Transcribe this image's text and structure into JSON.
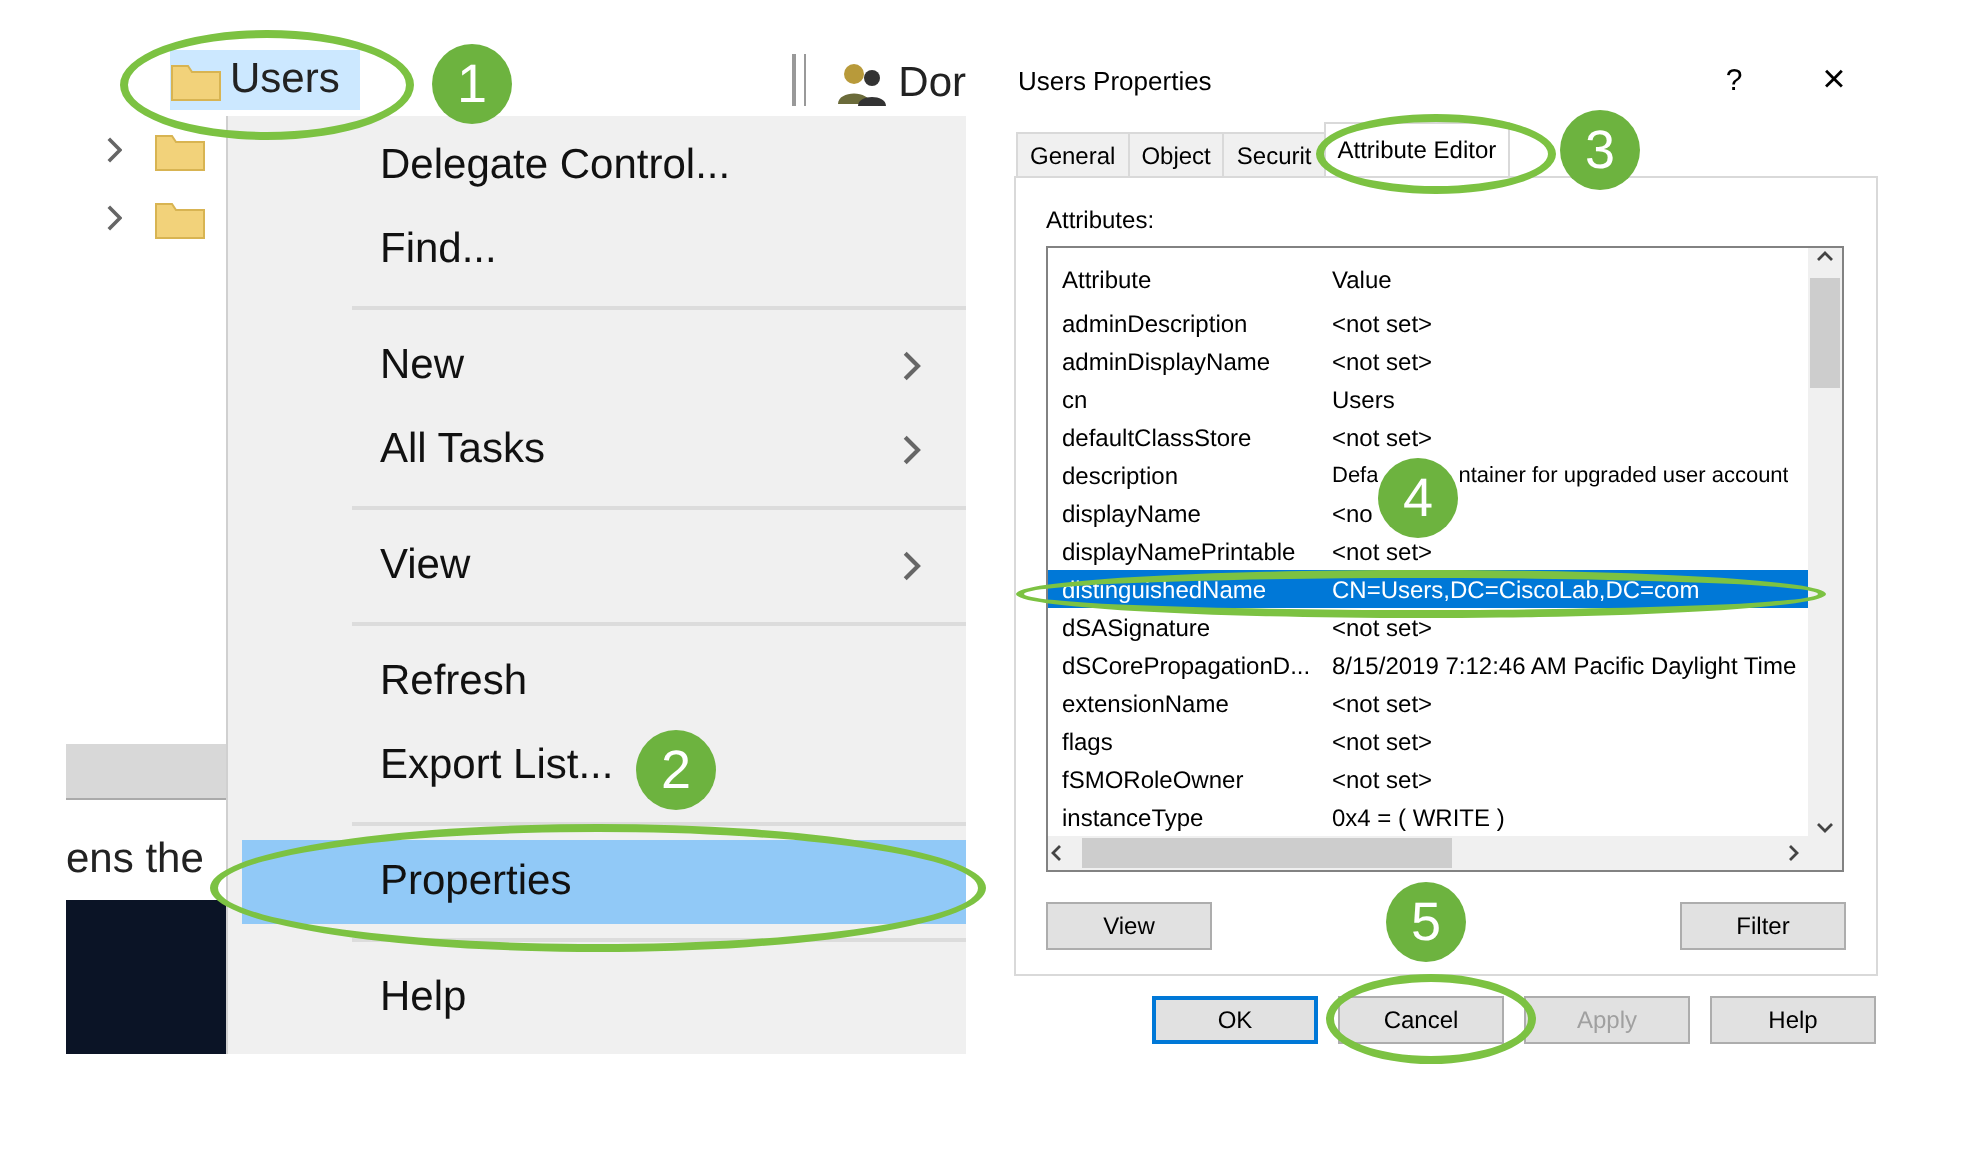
{
  "left_panel": {
    "tree": [
      {
        "label": "Users",
        "selected": true,
        "expandable": false
      },
      {
        "expandable": true
      },
      {
        "expandable": true
      }
    ],
    "header": {
      "label": "Dor"
    },
    "description_fragment": "ens the",
    "context_menu": [
      {
        "kind": "item",
        "label": "Delegate Control...",
        "submenu": false,
        "selected": false
      },
      {
        "kind": "item",
        "label": "Find...",
        "submenu": false,
        "selected": false
      },
      {
        "kind": "separator"
      },
      {
        "kind": "item",
        "label": "New",
        "submenu": true,
        "selected": false
      },
      {
        "kind": "item",
        "label": "All Tasks",
        "submenu": true,
        "selected": false
      },
      {
        "kind": "separator"
      },
      {
        "kind": "item",
        "label": "View",
        "submenu": true,
        "selected": false
      },
      {
        "kind": "separator"
      },
      {
        "kind": "item",
        "label": "Refresh",
        "submenu": false,
        "selected": false
      },
      {
        "kind": "item",
        "label": "Export List...",
        "submenu": false,
        "selected": false
      },
      {
        "kind": "separator"
      },
      {
        "kind": "item",
        "label": "Properties",
        "submenu": false,
        "selected": true
      },
      {
        "kind": "separator"
      },
      {
        "kind": "item",
        "label": "Help",
        "submenu": false,
        "selected": false
      }
    ]
  },
  "dialog": {
    "title": "Users Properties",
    "help": "?",
    "close": "×",
    "tabs": [
      {
        "label": "General",
        "selected": false
      },
      {
        "label": "Object",
        "selected": false
      },
      {
        "label": "Securit",
        "selected": false
      },
      {
        "label": "Attribute Editor",
        "selected": true
      }
    ],
    "attributes_label": "Attributes:",
    "columns": [
      "Attribute",
      "Value"
    ],
    "rows": [
      {
        "attribute": "adminDescription",
        "value": "<not set>",
        "selected": false
      },
      {
        "attribute": "adminDisplayName",
        "value": "<not set>",
        "selected": false
      },
      {
        "attribute": "cn",
        "value": "Users",
        "selected": false
      },
      {
        "attribute": "defaultClassStore",
        "value": "<not set>",
        "selected": false
      },
      {
        "attribute": "description",
        "value": "Defa",
        "value_tail": "ntainer for upgraded user account",
        "selected": false
      },
      {
        "attribute": "displayName",
        "value": "<no",
        "selected": false
      },
      {
        "attribute": "displayNamePrintable",
        "value": "<not set>",
        "selected": false
      },
      {
        "attribute": "distinguishedName",
        "value": "CN=Users,DC=CiscoLab,DC=com",
        "selected": true
      },
      {
        "attribute": "dSASignature",
        "value": "<not set>",
        "selected": false
      },
      {
        "attribute": "dSCorePropagationD...",
        "value": "8/15/2019 7:12:46 AM Pacific Daylight Time",
        "selected": false
      },
      {
        "attribute": "extensionName",
        "value": "<not set>",
        "selected": false
      },
      {
        "attribute": "flags",
        "value": "<not set>",
        "selected": false
      },
      {
        "attribute": "fSMORoleOwner",
        "value": "<not set>",
        "selected": false
      },
      {
        "attribute": "instanceType",
        "value": "0x4 = ( WRITE )",
        "selected": false
      }
    ],
    "list_buttons": [
      "View",
      "Filter"
    ],
    "buttons": [
      {
        "label": "OK",
        "default": true,
        "disabled": false
      },
      {
        "label": "Cancel",
        "default": false,
        "disabled": false
      },
      {
        "label": "Apply",
        "default": false,
        "disabled": true
      },
      {
        "label": "Help",
        "default": false,
        "disabled": false
      }
    ]
  },
  "annotations": {
    "steps": [
      "1",
      "2",
      "3",
      "4",
      "5"
    ]
  }
}
